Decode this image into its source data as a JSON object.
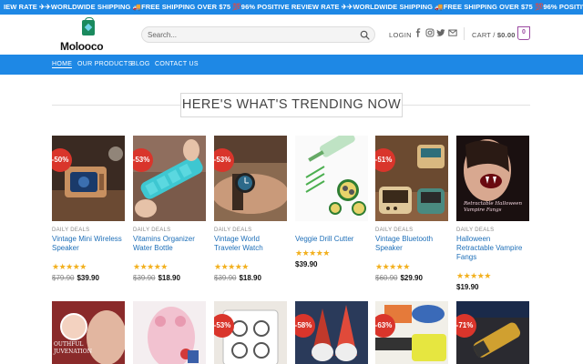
{
  "ticker": {
    "text": "IEW RATE ✈✈WORLDWIDE SHIPPING 🚚FREE SHIPPING OVER $75 💯96% POSITIVE REVIEW RATE ✈✈WORLDWIDE SHIPPING 🚚FREE SHIPPING OVER $75 💯96% POSITIVE REVIEW RATE ✈✈WORLDWIDE SHIP"
  },
  "header": {
    "logo_text": "Molooco",
    "search_placeholder": "Search...",
    "login_label": "LOGIN",
    "cart_label": "CART /",
    "cart_total": "$0.00",
    "cart_count": "0",
    "social_icons": [
      "facebook-icon",
      "instagram-icon",
      "twitter-icon",
      "email-icon"
    ]
  },
  "nav": {
    "items": [
      {
        "label": "HOME"
      },
      {
        "label": "OUR PRODUCTS"
      },
      {
        "label": "BLOG"
      },
      {
        "label": "CONTACT US"
      }
    ]
  },
  "section": {
    "title": "HERE'S WHAT'S TRENDING NOW"
  },
  "products": [
    {
      "badge": "-50%",
      "category": "DAILY DEALS",
      "name": "Vintage Mini Wireless Speaker",
      "stars": "★★★★★",
      "old_price": "$79.90",
      "new_price": "$39.90"
    },
    {
      "badge": "-53%",
      "category": "DAILY DEALS",
      "name": "Vitamins Organizer Water Bottle",
      "stars": "★★★★★",
      "old_price": "$39.90",
      "new_price": "$18.90"
    },
    {
      "badge": "-53%",
      "category": "DAILY DEALS",
      "name": "Vintage World Traveler Watch",
      "stars": "★★★★★",
      "old_price": "$39.90",
      "new_price": "$18.90"
    },
    {
      "badge": "",
      "category": "",
      "name": "Veggie Drill Cutter",
      "stars": "★★★★★",
      "old_price": "",
      "new_price": "$39.90"
    },
    {
      "badge": "-51%",
      "category": "DAILY DEALS",
      "name": "Vintage Bluetooth Speaker",
      "stars": "★★★★★",
      "old_price": "$60.90",
      "new_price": "$29.90"
    },
    {
      "badge": "",
      "category": "DAILY DEALS",
      "name": "Halloween Retractable Vampire Fangs",
      "stars": "★★★★★",
      "old_price": "",
      "new_price": "$19.90",
      "image_text": "Retractable Halloween Vampire Fangs"
    }
  ],
  "row2": [
    {
      "badge": "",
      "image_text": "OUTHFUL JUVENATION"
    },
    {
      "badge": ""
    },
    {
      "badge": "-53%"
    },
    {
      "badge": "-58%"
    },
    {
      "badge": "-63%"
    },
    {
      "badge": "-71%"
    }
  ]
}
